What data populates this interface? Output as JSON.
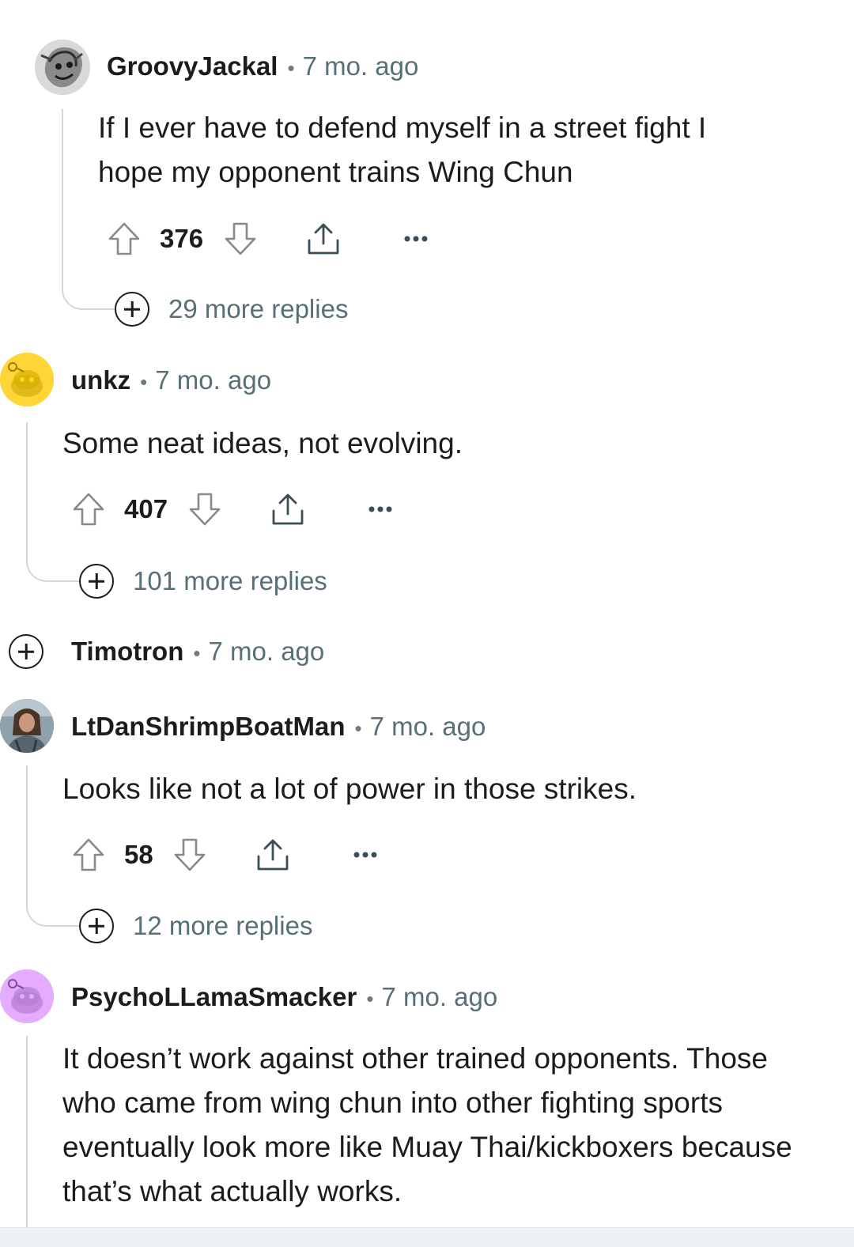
{
  "comments": [
    {
      "username": "GroovyJackal",
      "separator": "•",
      "time": "7 mo. ago",
      "body_lines": [
        "If I ever have to defend myself in a street fight I",
        "hope my opponent trains Wing Chun"
      ],
      "votes": "376",
      "more_replies": "29 more replies",
      "avatar": "sketch-portrait-avatar"
    },
    {
      "username": "unkz",
      "separator": "•",
      "time": "7 mo. ago",
      "body_lines": [
        "Some neat ideas, not evolving."
      ],
      "votes": "407",
      "more_replies": "101 more replies",
      "avatar": "snoo-yellow-avatar",
      "avatar_color": "#ffd635"
    },
    {
      "username": "Timotron",
      "separator": "•",
      "time": "7 mo. ago",
      "collapsed": true
    },
    {
      "username": "LtDanShrimpBoatMan",
      "separator": "•",
      "time": "7 mo. ago",
      "body_lines": [
        "Looks like not a lot of power in those strikes."
      ],
      "votes": "58",
      "more_replies": "12 more replies",
      "avatar": "photo-portrait-avatar"
    },
    {
      "username": "PsychoLLamaSmacker",
      "separator": "•",
      "time": "7 mo. ago",
      "body_lines": [
        "It doesn’t work against other trained opponents. Those",
        "who came from wing chun into other fighting sports",
        "eventually look more like Muay Thai/kickboxers because",
        "that’s what actually works."
      ],
      "avatar": "snoo-purple-avatar",
      "avatar_color": "#e4abff"
    }
  ],
  "icons": {
    "upvote": "upvote-icon",
    "downvote": "downvote-icon",
    "share": "share-icon",
    "overflow": "more-options-icon",
    "expand": "plus-circle-icon"
  }
}
